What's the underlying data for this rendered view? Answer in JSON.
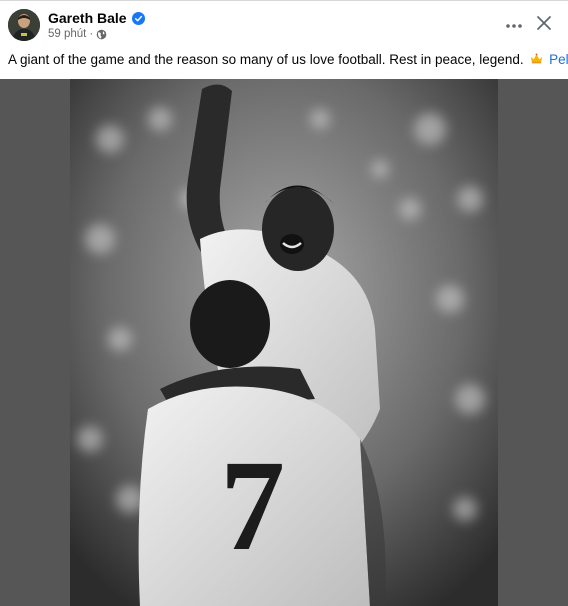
{
  "post": {
    "author_name": "Gareth Bale",
    "verified_icon": "verified-badge-icon",
    "timestamp": "59 phút",
    "separator": "·",
    "audience_icon": "globe-icon",
    "caption_text": "A giant of the game and the reason so many of us love football. Rest in peace, legend.",
    "caption_emoji": "crown-emoji",
    "mention": "Pelé",
    "more_icon": "more-options-icon",
    "close_icon": "close-icon",
    "photo_jersey_number": "7"
  },
  "colors": {
    "link": "#216fdb",
    "verified": "#1877f2",
    "secondary_text": "#65676b",
    "media_background": "#565656"
  }
}
